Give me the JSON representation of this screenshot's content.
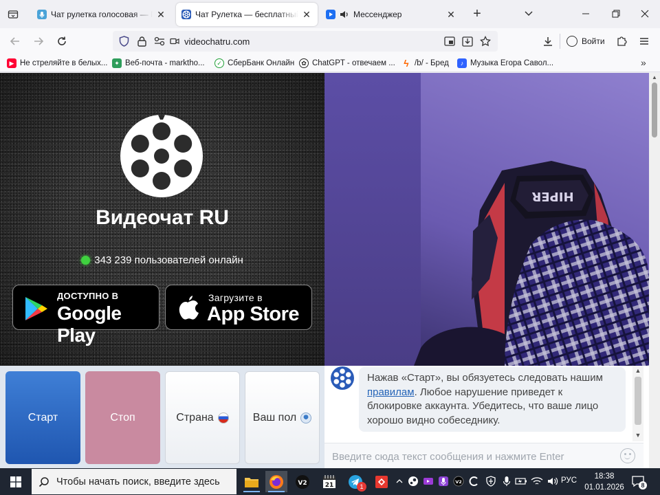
{
  "browser": {
    "tabs": [
      {
        "title": "Чат рулетка голосовая — Nektome",
        "active": false
      },
      {
        "title": "Чат Рулетка — бесплатный видеочат",
        "active": true
      },
      {
        "title": "Мессенджер",
        "active": false
      }
    ],
    "url": "videochatru.com",
    "signin_label": "Войти",
    "bookmarks": [
      {
        "label": "Не стреляйте в белых...",
        "color": "#ff0033"
      },
      {
        "label": "Веб-почта - marktho...",
        "color": "#2e9d5b"
      },
      {
        "label": "СберБанк Онлайн",
        "color": "#21a038"
      },
      {
        "label": "ChatGPT - отвечаем ...",
        "color": "#222222"
      },
      {
        "label": "/b/ - Бред",
        "color": "#ff6600"
      },
      {
        "label": "Музыка Егора Савол...",
        "color": "#2f62ff"
      }
    ]
  },
  "page": {
    "brand": "Видеочат RU",
    "online_text": "343 239 пользователей онлайн",
    "google_play": {
      "small": "ДОСТУПНО В",
      "big": "Google Play"
    },
    "app_store": {
      "small": "Загрузите в",
      "big": "App Store"
    },
    "webcam_chair_text": "HIPER",
    "buttons": {
      "start": "Старт",
      "stop": "Стоп",
      "country": "Страна",
      "gender": "Ваш пол"
    },
    "chat": {
      "notice_before": "Нажав «Старт», вы обязуетесь следовать нашим ",
      "notice_link": "правилам",
      "notice_after": ". Любое нарушение приведет к блокировке аккаунта. Убедитесь, что ваше лицо хорошо видно собеседнику.",
      "input_placeholder": "Введите сюда текст сообщения и нажмите Enter"
    }
  },
  "taskbar": {
    "search_placeholder": "Чтобы начать поиск, введите здесь",
    "language": "РУС",
    "time": "18:38",
    "date": "01.01.2026",
    "notification_count": "8",
    "telegram_badge": "1",
    "calendar_day": "21"
  },
  "colors": {
    "start_button": "#2d6bc7",
    "stop_button": "#c98aa0",
    "online_dot": "#3fd13f",
    "link": "#2363b7"
  }
}
